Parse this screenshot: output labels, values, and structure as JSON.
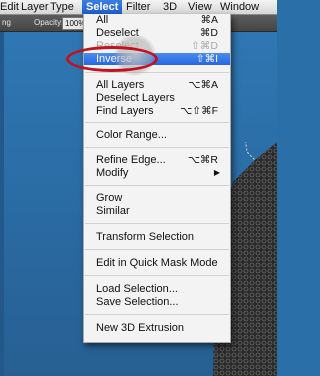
{
  "menubar": {
    "items": [
      "Edit",
      "Layer",
      "Type",
      "Select",
      "Filter",
      "3D",
      "View",
      "Window"
    ]
  },
  "options_bar": {
    "left_label": "ng",
    "opacity_label": "Opacity:",
    "opacity_value": "100%"
  },
  "select_menu": {
    "items": [
      {
        "label": "All",
        "shortcut": "⌘A"
      },
      {
        "label": "Deselect",
        "shortcut": "⌘D"
      },
      {
        "label": "Reselect",
        "shortcut": "⇧⌘D",
        "disabled": true
      },
      {
        "label": "Inverse",
        "shortcut": "⇧⌘I",
        "highlighted": true
      },
      {
        "label": "All Layers",
        "shortcut": "⌥⌘A"
      },
      {
        "label": "Deselect Layers",
        "shortcut": ""
      },
      {
        "label": "Find Layers",
        "shortcut": "⌥⇧⌘F"
      },
      {
        "label": "Color Range...",
        "shortcut": ""
      },
      {
        "label": "Refine Edge...",
        "shortcut": "⌥⌘R"
      },
      {
        "label": "Modify",
        "shortcut": "",
        "submenu": true
      },
      {
        "label": "Grow",
        "shortcut": ""
      },
      {
        "label": "Similar",
        "shortcut": ""
      },
      {
        "label": "Transform Selection",
        "shortcut": ""
      },
      {
        "label": "Edit in Quick Mask Mode",
        "shortcut": ""
      },
      {
        "label": "Load Selection...",
        "shortcut": ""
      },
      {
        "label": "Save Selection...",
        "shortcut": ""
      },
      {
        "label": "New 3D Extrusion",
        "shortcut": ""
      }
    ]
  },
  "colors": {
    "canvas_bg": "#2b6fa8",
    "menu_highlight": "#2667e0",
    "annotation_ring": "#c2121d"
  },
  "icons": {
    "submenu": "chevron-right-icon"
  }
}
